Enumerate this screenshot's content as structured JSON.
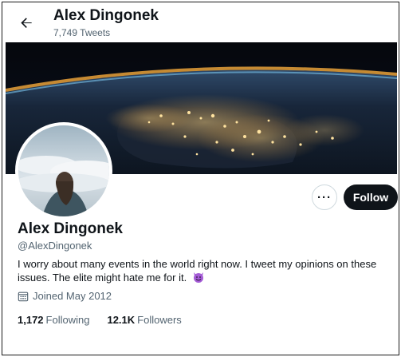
{
  "header": {
    "name": "Alex Dingonek",
    "tweets": "7,749 Tweets",
    "back_icon": "arrow-left-icon"
  },
  "profile": {
    "display_name": "Alex Dingonek",
    "handle": "@AlexDingonek",
    "bio": "I worry about many events in the world right now. I tweet my opinions on these issues. The elite might hate me for it.",
    "bio_emoji": "smiling-devil-emoji",
    "joined": "Joined May 2012",
    "joined_icon": "calendar-icon"
  },
  "actions": {
    "more_label": "···",
    "follow_label": "Follow"
  },
  "stats": {
    "following_count": "1,172",
    "following_label": "Following",
    "followers_count": "12.1K",
    "followers_label": "Followers"
  },
  "colors": {
    "text": "#0f1419",
    "secondary": "#536471",
    "button_dark": "#0f1419",
    "emoji": "#a45bd6"
  }
}
